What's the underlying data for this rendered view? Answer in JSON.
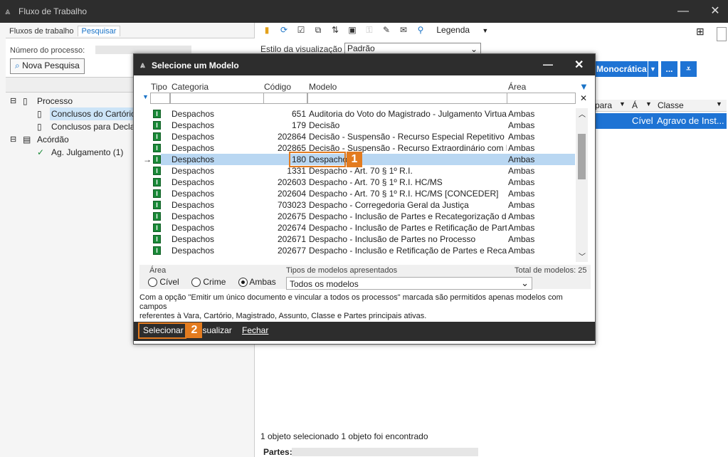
{
  "window": {
    "title": "Fluxo de Trabalho"
  },
  "left": {
    "tabs": [
      "Fluxos de trabalho",
      "Pesquisar"
    ],
    "process_label": "Número do processo:",
    "new_search": "Nova Pesquisa",
    "tree": [
      {
        "label": "Processo",
        "expander": "⊟",
        "indent": 0,
        "icon": "document-icon"
      },
      {
        "label": "Conclusos do Cartório",
        "indent": 1,
        "icon": "document-icon",
        "selected": true
      },
      {
        "label": "Conclusos para Declara",
        "indent": 1,
        "icon": "document-icon"
      },
      {
        "label": "Acórdão",
        "expander": "⊟",
        "indent": 0,
        "icon": "stack-icon"
      },
      {
        "label": "Ag. Julgamento (1)",
        "indent": 1,
        "icon": "check-icon"
      }
    ]
  },
  "right": {
    "legend": "Legenda",
    "view_style_label": "Estilo da visualização",
    "view_style_value": "Padrão",
    "monocratica": "Monocrática",
    "more": "...",
    "col_headers": [
      "para",
      "Á",
      "Classe"
    ],
    "row_values": [
      "Cível",
      "Agravo de Inst..."
    ],
    "status": "1 objeto selecionado  1 objeto foi encontrado",
    "partes_label": "Partes:"
  },
  "dialog": {
    "title": "Selecione um Modelo",
    "headers": {
      "tipo": "Tipo",
      "categoria": "Categoria",
      "codigo": "Código",
      "modelo": "Modelo",
      "area": "Área"
    },
    "rows": [
      {
        "cat": "Despachos",
        "code": "651",
        "model": "Auditoria do Voto do Magistrado - Julgamento Virtual",
        "area": "Ambas"
      },
      {
        "cat": "Despachos",
        "code": "179",
        "model": "Decisão",
        "area": "Ambas"
      },
      {
        "cat": "Despachos",
        "code": "202864",
        "model": "Decisão - Suspensão - Recurso Especial Repetitivo",
        "area": "Ambas"
      },
      {
        "cat": "Despachos",
        "code": "202865",
        "model": "Decisão - Suspensão - Recurso Extraordinário com Rep",
        "area": "Ambas"
      },
      {
        "cat": "Despachos",
        "code": "180",
        "model": "Despacho",
        "area": "Ambas",
        "selected": true
      },
      {
        "cat": "Despachos",
        "code": "1331",
        "model": "Despacho - Art. 70 § 1º R.I.",
        "area": "Ambas"
      },
      {
        "cat": "Despachos",
        "code": "202603",
        "model": "Despacho - Art. 70 § 1º R.I. HC/MS",
        "area": "Ambas"
      },
      {
        "cat": "Despachos",
        "code": "202604",
        "model": "Despacho - Art. 70 § 1º R.I. HC/MS [CONCEDER]",
        "area": "Ambas"
      },
      {
        "cat": "Despachos",
        "code": "703023",
        "model": "Despacho - Corregedoria Geral da Justiça",
        "area": "Ambas"
      },
      {
        "cat": "Despachos",
        "code": "202675",
        "model": "Despacho - Inclusão de Partes e Recategorização de Do",
        "area": "Ambas"
      },
      {
        "cat": "Despachos",
        "code": "202674",
        "model": "Despacho - Inclusão de Partes e Retificação de Partes n",
        "area": "Ambas"
      },
      {
        "cat": "Despachos",
        "code": "202671",
        "model": "Despacho - Inclusão de Partes no Processo",
        "area": "Ambas"
      },
      {
        "cat": "Despachos",
        "code": "202677",
        "model": "Despacho - Inclusão e Retificação de Partes e Recatego",
        "area": "Ambas"
      }
    ],
    "area_label": "Área",
    "radios": [
      {
        "label": "Cível",
        "checked": false
      },
      {
        "label": "Crime",
        "checked": false
      },
      {
        "label": "Ambas",
        "checked": true
      }
    ],
    "types_label": "Tipos de modelos apresentados",
    "types_value": "Todos os modelos",
    "total": "Total de modelos: 25",
    "info": "Com a opção \"Emitir um único documento e vincular a todos os processos\" marcada são permitidos apenas modelos com campos\nreferentes à Vara, Cartório, Magistrado, Assunto, Classe e Partes principais ativas.",
    "buttons": {
      "select": "Selecionar",
      "view": "Visualizar",
      "close": "Fechar"
    },
    "badges": [
      "1",
      "2"
    ]
  }
}
